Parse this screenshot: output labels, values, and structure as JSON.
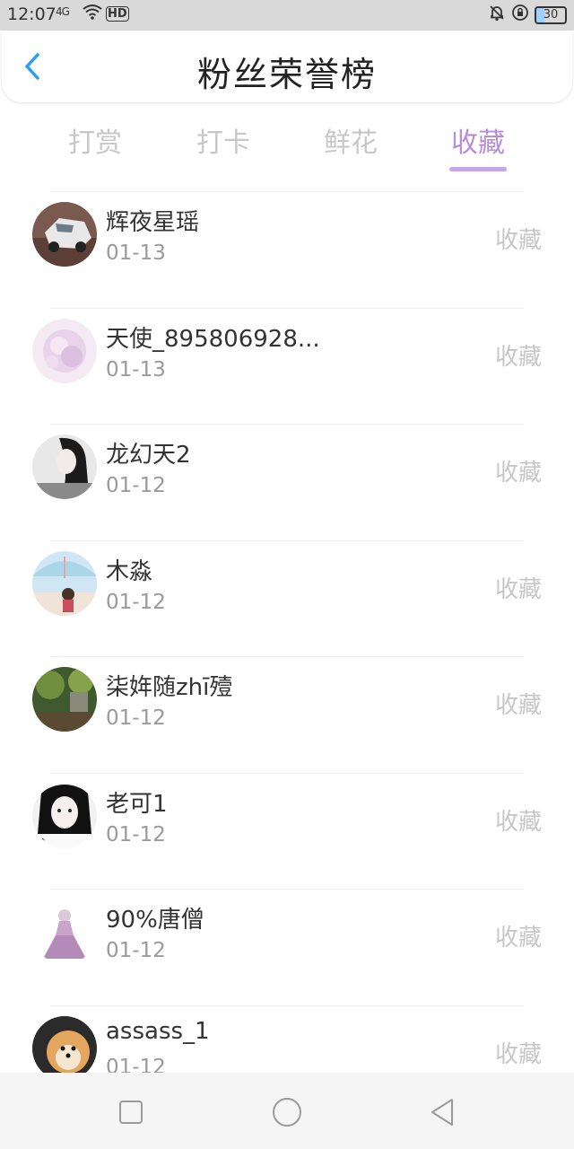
{
  "status_bar": {
    "time": "12:07",
    "signal": "4G",
    "hd": "HD",
    "battery": "30"
  },
  "header": {
    "title": "粉丝荣誉榜"
  },
  "tabs": [
    {
      "label": "打赏",
      "active": false
    },
    {
      "label": "打卡",
      "active": false
    },
    {
      "label": "鲜花",
      "active": false
    },
    {
      "label": "收藏",
      "active": true
    }
  ],
  "fans": [
    {
      "name": "辉夜星瑶",
      "date": "01-13",
      "action": "收藏",
      "avatar": "car-photo-avatar"
    },
    {
      "name": "天使_895806928...",
      "date": "01-13",
      "action": "收藏",
      "avatar": "pink-flower-avatar"
    },
    {
      "name": "龙幻天2",
      "date": "01-12",
      "action": "收藏",
      "avatar": "girl-bw-avatar"
    },
    {
      "name": "木淼",
      "date": "01-12",
      "action": "收藏",
      "avatar": "child-umbrella-avatar"
    },
    {
      "name": "柒姩随zhī殪",
      "date": "01-12",
      "action": "收藏",
      "avatar": "garden-avatar"
    },
    {
      "name": "老可1",
      "date": "01-12",
      "action": "收藏",
      "avatar": "girl-face-avatar"
    },
    {
      "name": "90%唐僧",
      "date": "01-12",
      "action": "收藏",
      "avatar": "anime-girl-avatar"
    },
    {
      "name": "assass_1",
      "date": "01-12",
      "action": "收藏",
      "avatar": "puppy-avatar"
    }
  ],
  "colors": {
    "accent": "#b78ddb",
    "back_arrow": "#2a9df4",
    "muted": "#c7c7c7"
  }
}
